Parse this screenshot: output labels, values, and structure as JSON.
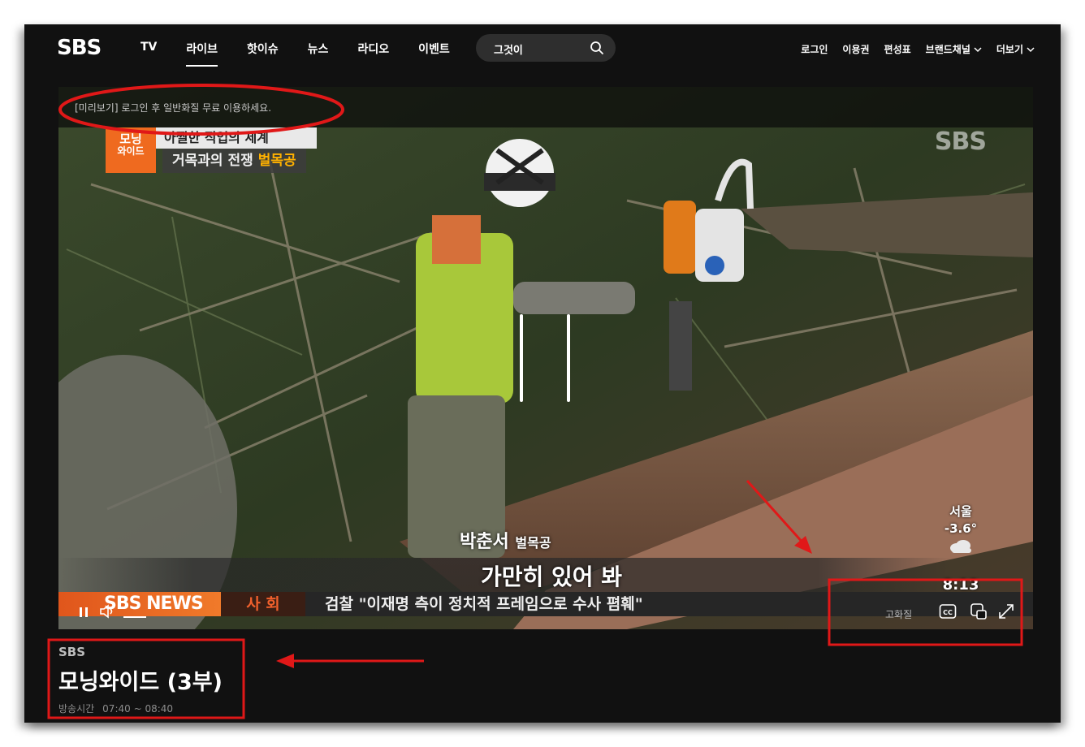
{
  "header": {
    "logo": "SBS",
    "nav": [
      "TV",
      "라이브",
      "핫이슈",
      "뉴스",
      "라디오",
      "이벤트"
    ],
    "active_nav": "라이브",
    "search": {
      "value": "그것이",
      "icon": "search-icon"
    },
    "util": [
      {
        "label": "로그인"
      },
      {
        "label": "이용권"
      },
      {
        "label": "편성표"
      },
      {
        "label": "브랜드채널",
        "icon": "chevron-down-icon"
      },
      {
        "label": "더보기",
        "icon": "chevron-down-icon"
      }
    ]
  },
  "player": {
    "preview_notice": "[미리보기] 로그인 후 일반화질 무료 이용하세요.",
    "program_tag": [
      "모닝",
      "와이드"
    ],
    "top_caption_1": "아찔한 직업의 세계",
    "top_caption_2_prefix": "거목과의 전쟁",
    "top_caption_2_highlight": "벌목공",
    "watermark": "SBS",
    "speaker_name": "박춘서",
    "speaker_role": "벌목공",
    "quote": "가만히 있어 봐",
    "weather": {
      "city": "서울",
      "temp": "-3.6°",
      "time": "8:13"
    },
    "ticker": {
      "logo": "SBS NEWS",
      "category": "사 회",
      "headline": "검찰 \"이재명 측이 정치적 프레임으로 수사 폄훼\""
    },
    "controls": {
      "quality": "고화질"
    }
  },
  "program": {
    "channel": "SBS",
    "title": "모닝와이드 (3부)",
    "time_label": "방송시간",
    "time_value": "07:40 ~ 08:40"
  },
  "colors": {
    "background": "#111111",
    "accent_orange": "#ef6a1f",
    "annotation_red": "#e01818"
  }
}
